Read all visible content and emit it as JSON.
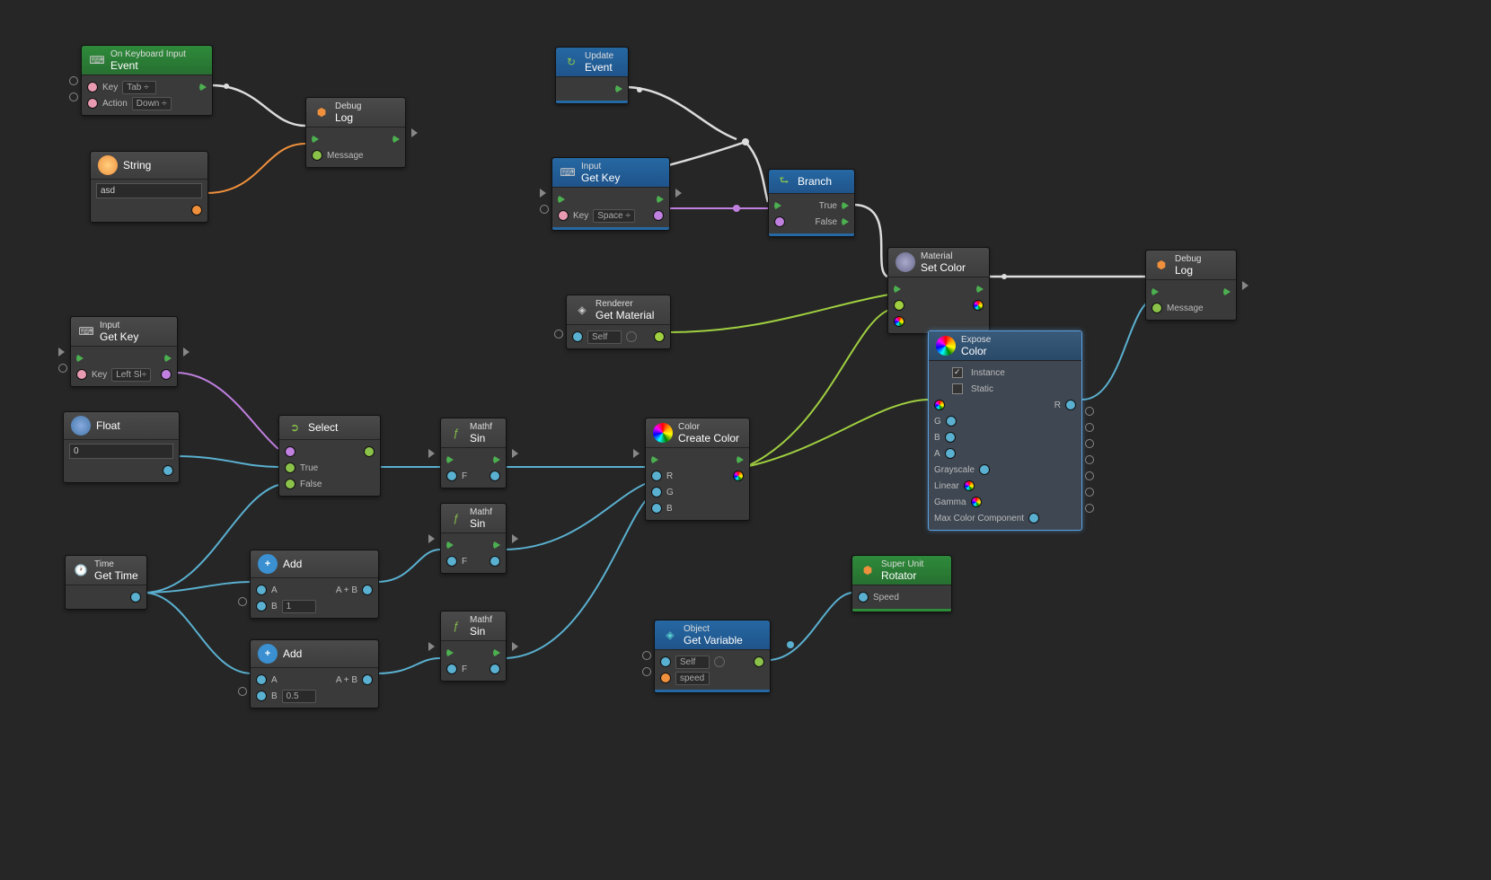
{
  "nodes": {
    "onKeyboard": {
      "cat": "On Keyboard Input",
      "name": "Event",
      "key_lbl": "Key",
      "key_val": "Tab ÷",
      "action_lbl": "Action",
      "action_val": "Down ÷"
    },
    "string": {
      "name": "String",
      "value": "asd"
    },
    "debug1": {
      "cat": "Debug",
      "name": "Log",
      "msg": "Message"
    },
    "update": {
      "cat": "Update",
      "name": "Event"
    },
    "getKey1": {
      "cat": "Input",
      "name": "Get Key",
      "key_lbl": "Key",
      "key_val": "Space ÷"
    },
    "branch": {
      "name": "Branch",
      "t": "True",
      "f": "False"
    },
    "setColor": {
      "cat": "Material",
      "name": "Set Color"
    },
    "debug2": {
      "cat": "Debug",
      "name": "Log",
      "msg": "Message"
    },
    "getMat": {
      "cat": "Renderer",
      "name": "Get Material",
      "self": "Self"
    },
    "getKey2": {
      "cat": "Input",
      "name": "Get Key",
      "key_lbl": "Key",
      "key_val": "Left Sl÷"
    },
    "float": {
      "name": "Float",
      "value": "0"
    },
    "select": {
      "name": "Select",
      "t": "True",
      "f": "False"
    },
    "sin1": {
      "cat": "Mathf",
      "name": "Sin",
      "f": "F"
    },
    "sin2": {
      "cat": "Mathf",
      "name": "Sin",
      "f": "F"
    },
    "sin3": {
      "cat": "Mathf",
      "name": "Sin",
      "f": "F"
    },
    "createColor": {
      "cat": "Color",
      "name": "Create Color",
      "r": "R",
      "g": "G",
      "b": "B"
    },
    "expose": {
      "cat": "Expose",
      "name": "Color",
      "inst": "Instance",
      "stat": "Static",
      "r": "R",
      "g": "G",
      "b": "B",
      "a": "A",
      "grey": "Grayscale",
      "lin": "Linear",
      "gam": "Gamma",
      "max": "Max Color Component"
    },
    "time": {
      "cat": "Time",
      "name": "Get Time"
    },
    "add1": {
      "name": "Add",
      "a": "A",
      "b": "B",
      "bval": "1",
      "out": "A + B"
    },
    "add2": {
      "name": "Add",
      "a": "A",
      "b": "B",
      "bval": "0.5",
      "out": "A + B"
    },
    "getVar": {
      "cat": "Object",
      "name": "Get Variable",
      "self": "Self",
      "var": "speed"
    },
    "rotator": {
      "cat": "Super Unit",
      "name": "Rotator",
      "speed": "Speed"
    }
  }
}
